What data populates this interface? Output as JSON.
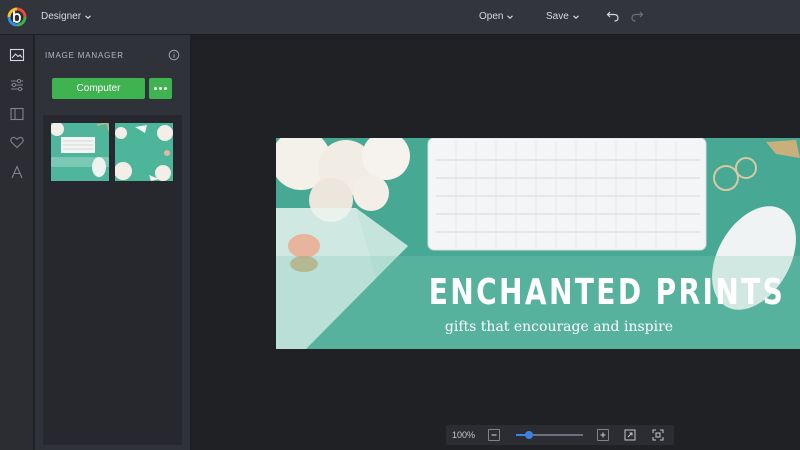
{
  "header": {
    "app_menu_label": "Designer",
    "open_label": "Open",
    "save_label": "Save"
  },
  "icons": {
    "logo": "befunky-logo",
    "undo": "undo-icon",
    "redo": "redo-icon",
    "rail": [
      "image-manager-icon",
      "adjust-sliders-icon",
      "layout-icon",
      "heart-icon",
      "text-icon"
    ]
  },
  "panel": {
    "title": "IMAGE MANAGER",
    "computer_button": "Computer",
    "thumbnails": [
      "thumbnail-1",
      "thumbnail-2"
    ]
  },
  "banner": {
    "title": "ENCHANTED PRINTS",
    "subtitle": "gifts that encourage and inspire"
  },
  "zoom": {
    "value_text": "100%",
    "level_fraction": 0.2
  },
  "colors": {
    "accent_green": "#3fb34f",
    "slider_blue": "#3b82e4",
    "banner_teal": "#4bab95"
  }
}
